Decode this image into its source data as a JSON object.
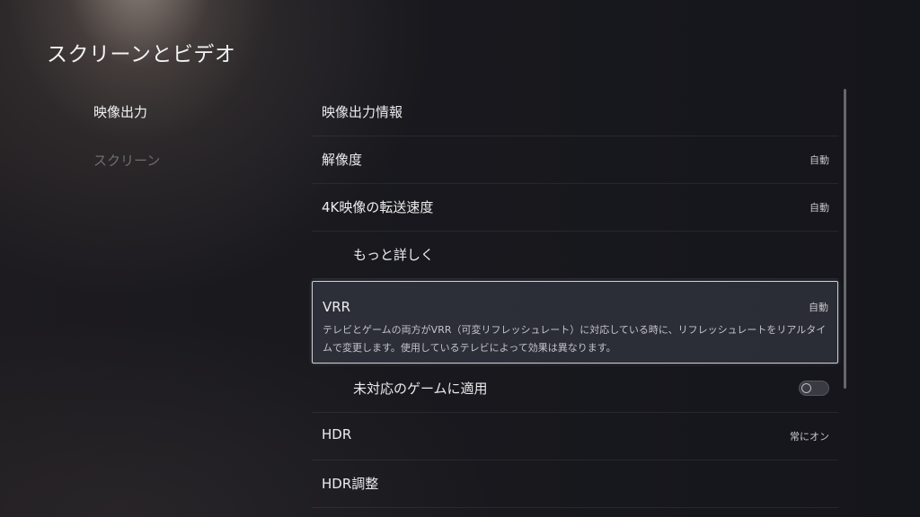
{
  "header": {
    "title": "スクリーンとビデオ"
  },
  "sidebar": {
    "items": [
      {
        "label": "映像出力",
        "active": true
      },
      {
        "label": "スクリーン",
        "active": false
      }
    ]
  },
  "settings": {
    "video_output_info": {
      "label": "映像出力情報"
    },
    "resolution": {
      "label": "解像度",
      "value": "自動"
    },
    "transfer_rate_4k": {
      "label": "4K映像の転送速度",
      "value": "自動"
    },
    "more_details": {
      "label": "もっと詳しく"
    },
    "vrr": {
      "label": "VRR",
      "value": "自動",
      "description": "テレビとゲームの両方がVRR（可変リフレッシュレート）に対応している時に、リフレッシュレートをリアルタイムで変更します。使用しているテレビによって効果は異なります。"
    },
    "apply_unsupported": {
      "label": "未対応のゲームに適用",
      "enabled": false
    },
    "hdr": {
      "label": "HDR",
      "value": "常にオン"
    },
    "hdr_adjust": {
      "label": "HDR調整"
    }
  },
  "colors": {
    "background": "#1a1a20",
    "selected_border": "#cfcfd6",
    "inactive_text": "#6e6e74"
  }
}
